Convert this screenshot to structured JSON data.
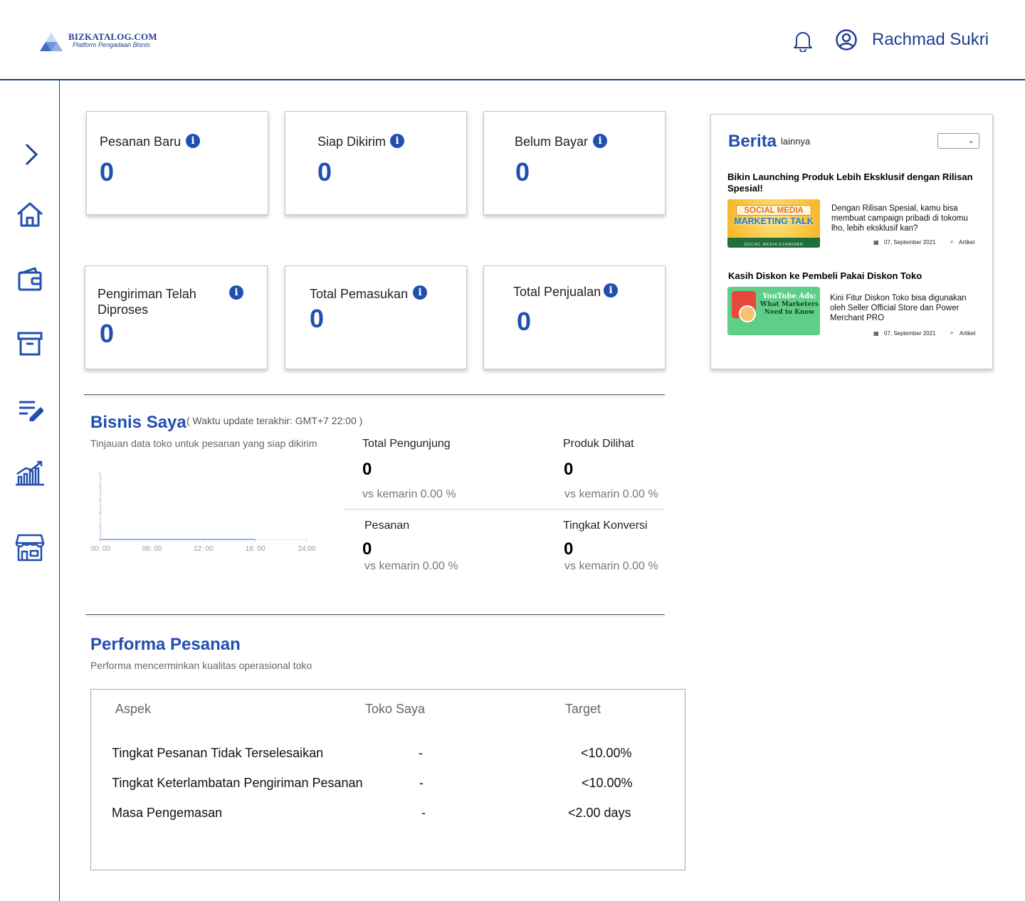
{
  "header": {
    "logo_name": "BIZKATALOG.COM",
    "logo_tagline": "Platform Pengadaan Bisnis",
    "user_name": "Rachmad Sukri",
    "icons": [
      "bell-icon",
      "user-circle-icon"
    ]
  },
  "sidebar": {
    "items": [
      {
        "icon": "chevron-right-icon"
      },
      {
        "icon": "home-icon"
      },
      {
        "icon": "wallet-icon"
      },
      {
        "icon": "archive-box-icon"
      },
      {
        "icon": "edit-list-icon"
      },
      {
        "icon": "chart-growth-icon"
      },
      {
        "icon": "store-icon"
      }
    ]
  },
  "stats": [
    {
      "label": "Pesanan Baru",
      "value": "0"
    },
    {
      "label": "Siap Dikirim",
      "value": "0"
    },
    {
      "label": "Belum Bayar",
      "value": "0"
    },
    {
      "label": "Pengiriman Telah\nDiproses",
      "value": "0"
    },
    {
      "label": "Total Pemasukan",
      "value": "0"
    },
    {
      "label": "Total Penjualan",
      "value": "0"
    }
  ],
  "news": {
    "title": "Berita",
    "more": "lainnya",
    "articles": [
      {
        "title": "Bikin Launching Produk Lebih Eksklusif dengan Rilisan Spesial!",
        "thumb_line1": "SOCIAL MEDIA",
        "thumb_line2": "MARKETING TALK",
        "thumb_footer": "SOCIAL MEDIA EXAMINER",
        "desc": "Dengan Rilisan Spesial, kamu bisa membuat campaign pribadi di tokomu lho, lebih eksklusif kan?",
        "date": "07, September 2021",
        "category": "Artikel"
      },
      {
        "title": "Kasih Diskon ke Pembeli Pakai Diskon Toko",
        "thumb_line1": "YouTube Ads:",
        "thumb_line2": "What Marketers",
        "thumb_line3": "Need to Know",
        "desc": "Kini Fitur Diskon Toko bisa digunakan oleh Seller Official Store dan Power Merchant PRO",
        "date": "07, September 2021",
        "category": "Artikel"
      }
    ]
  },
  "bisnis": {
    "title": "Bisnis Saya",
    "update": "( Waktu update terakhir: GMT+7 22:00 )",
    "subtitle": "Tinjauan data toko untuk pesanan yang siap dikirim",
    "metrics": [
      {
        "label": "Total Pengunjung",
        "value": "0",
        "compare": "vs kemarin 0.00 %"
      },
      {
        "label": "Produk Dilihat",
        "value": "0",
        "compare": "vs kemarin 0.00 %"
      },
      {
        "label": "Pesanan",
        "value": "0",
        "compare": "vs kemarin 0.00 %"
      },
      {
        "label": "Tingkat Konversi",
        "value": "0",
        "compare": "vs kemarin 0.00 %"
      }
    ]
  },
  "chart_data": {
    "type": "line",
    "x": [
      "00: 00",
      "06: 00",
      "12: 00",
      "18: 00",
      "24:00"
    ],
    "series": [
      {
        "values": [
          0,
          0,
          0,
          0
        ]
      }
    ],
    "color": "#8fb5e8"
  },
  "performa": {
    "title": "Performa Pesanan",
    "subtitle": "Performa mencerminkan kualitas operasional toko",
    "headers": [
      "Aspek",
      "Toko Saya",
      "Target"
    ],
    "rows": [
      {
        "aspek": "Tingkat Pesanan Tidak Terselesaikan",
        "toko": "-",
        "target": "<10.00%"
      },
      {
        "aspek": "Tingkat Keterlambatan Pengiriman Pesanan",
        "toko": "-",
        "target": "<10.00%"
      },
      {
        "aspek": "Masa Pengemasan",
        "toko": "-",
        "target": "<2.00 days"
      }
    ]
  },
  "colors": {
    "brand": "#1f4fb0",
    "nav": "#1f3f8f"
  }
}
